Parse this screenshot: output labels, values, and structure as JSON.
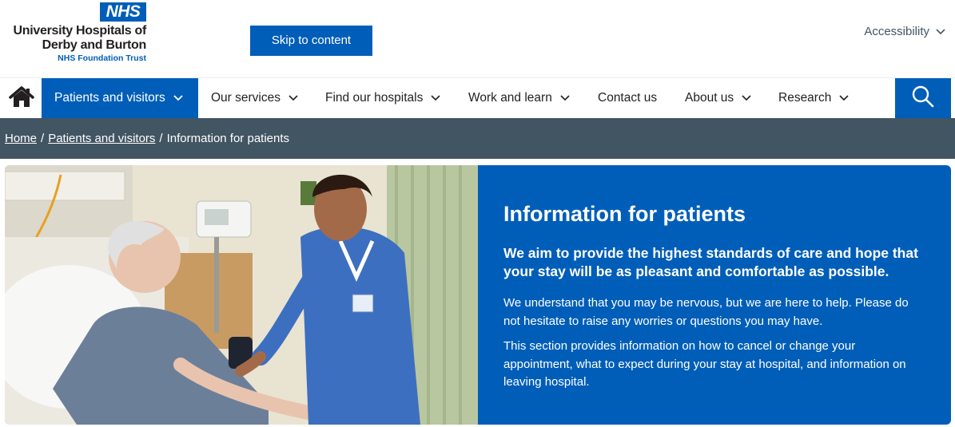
{
  "header": {
    "logo": {
      "badge": "NHS",
      "line1": "University Hospitals of",
      "line2": "Derby and Burton",
      "trust": "NHS Foundation Trust"
    },
    "skip_label": "Skip to content",
    "accessibility_label": "Accessibility"
  },
  "nav": {
    "items": [
      {
        "label": "Patients and visitors",
        "active": true
      },
      {
        "label": "Our services"
      },
      {
        "label": "Find our hospitals"
      },
      {
        "label": "Work and learn"
      },
      {
        "label": "Contact us"
      },
      {
        "label": "About us"
      },
      {
        "label": "Research"
      }
    ],
    "icons": {
      "home": "home-icon",
      "search": "search-icon",
      "dropdown": "chevron-down-icon"
    }
  },
  "breadcrumb": {
    "home": "Home",
    "separator": "/",
    "parent": "Patients and visitors",
    "current": "Information for patients"
  },
  "hero": {
    "title": "Information for patients",
    "lead": "We aim to provide the highest standards of care and hope that your stay will be as pleasant and comfortable as possible.",
    "paragraphs": [
      "We understand that you may be nervous, but we are here to help. Please do not hesitate to raise any worries or questions you may have.",
      "This section provides information on how to cancel or change your appointment, what to expect during your stay at hospital, and information on leaving hospital."
    ]
  },
  "colors": {
    "nhs_blue": "#005eb8",
    "breadcrumb_bg": "#425563",
    "text_dark": "#231f20"
  }
}
